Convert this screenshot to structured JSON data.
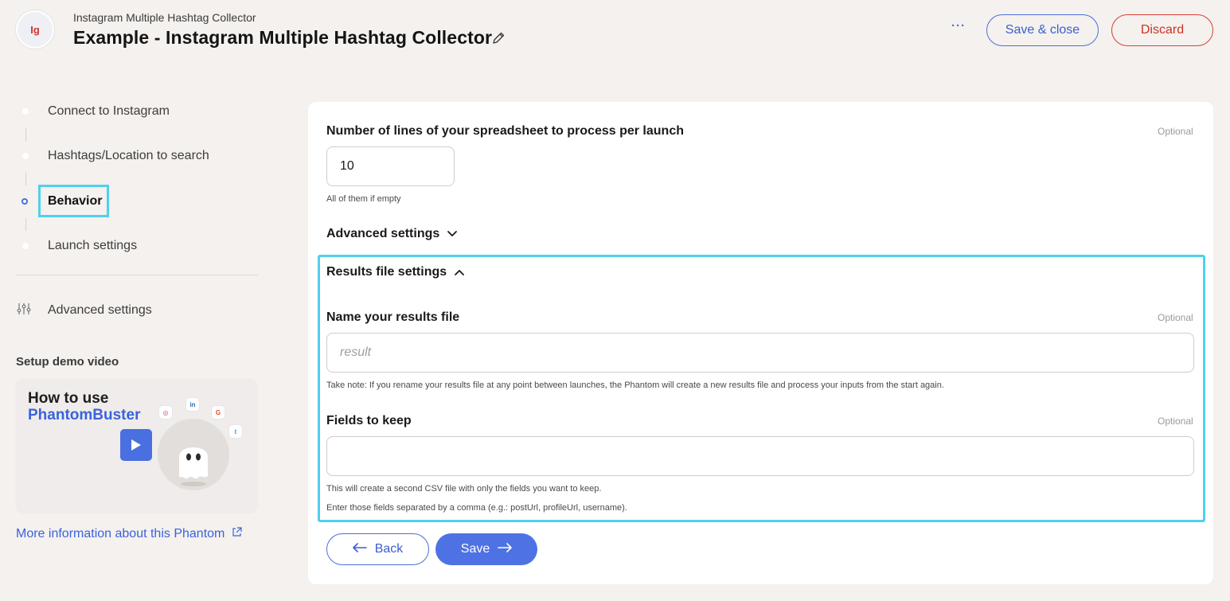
{
  "header": {
    "app_badge": "Ig",
    "subtitle": "Instagram Multiple Hashtag Collector",
    "title": "Example - Instagram Multiple Hashtag Collector",
    "more_label": "···",
    "save_close_label": "Save & close",
    "discard_label": "Discard"
  },
  "sidebar": {
    "steps": [
      {
        "label": "Connect to Instagram",
        "active": false
      },
      {
        "label": "Hashtags/Location to search",
        "active": false
      },
      {
        "label": "Behavior",
        "active": true
      },
      {
        "label": "Launch settings",
        "active": false
      }
    ],
    "advanced_settings_label": "Advanced settings",
    "demo_title": "Setup demo video",
    "demo_card": {
      "line1": "How to use",
      "line2": "PhantomBuster"
    },
    "more_info_label": "More information about this Phantom"
  },
  "form": {
    "lines_per_launch": {
      "label": "Number of lines of your spreadsheet to process per launch",
      "optional": "Optional",
      "value": "10",
      "hint": "All of them if empty"
    },
    "advanced_settings_toggle": "Advanced settings",
    "results_file_settings_toggle": "Results file settings",
    "results_file_name": {
      "label": "Name your results file",
      "optional": "Optional",
      "placeholder": "result",
      "hint": "Take note: If you rename your results file at any point between launches, the Phantom will create a new results file and process your inputs from the start again."
    },
    "fields_to_keep": {
      "label": "Fields to keep",
      "optional": "Optional",
      "value": "",
      "hint1": "This will create a second CSV file with only the fields you want to keep.",
      "hint2": "Enter those fields separated by a comma (e.g.: postUrl, profileUrl, username)."
    },
    "back_label": "Back",
    "save_label": "Save"
  },
  "colors": {
    "accent": "#4e72e4",
    "discard": "#d94232",
    "highlight": "#4fd0ec",
    "background": "#f4f1ee"
  }
}
